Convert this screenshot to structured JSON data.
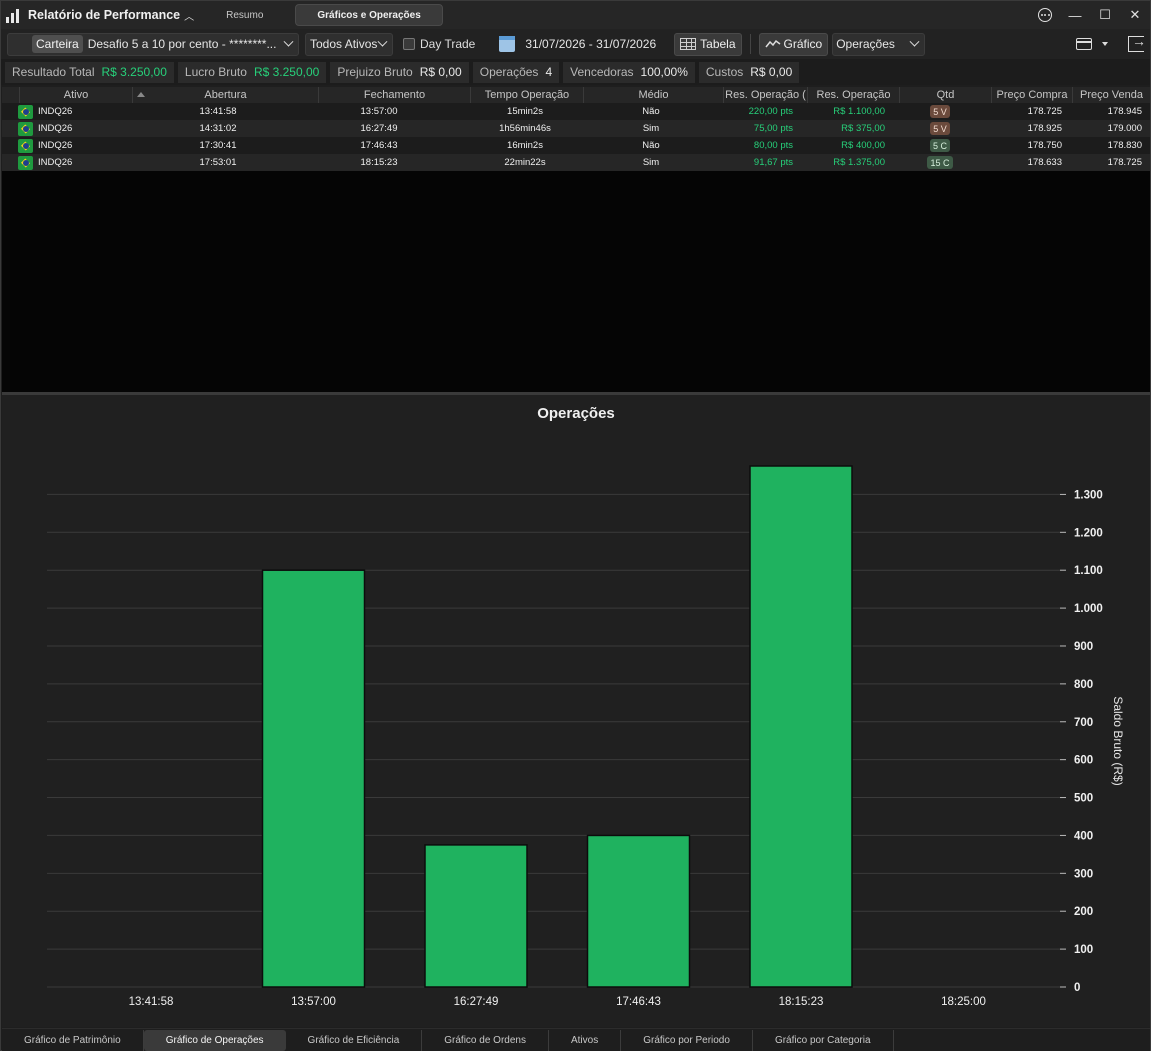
{
  "window": {
    "title": "Relatório de Performance",
    "tabs": [
      {
        "label": "Resumo",
        "active": false
      },
      {
        "label": "Gráficos e Operações",
        "active": true
      }
    ]
  },
  "toolbar": {
    "carteira_tag": "Carteira",
    "carteira_value": "Desafio 5 a 10 por cento  - ********...",
    "ativos_value": "Todos Ativos",
    "day_trade_label": "Day Trade",
    "day_trade_checked": false,
    "date_range": "31/07/2026 - 31/07/2026",
    "tabela_label": "Tabela",
    "grafico_label": "Gráfico",
    "operacoes_select": "Operações"
  },
  "summary": [
    {
      "label": "Resultado Total",
      "value": "R$ 3.250,00",
      "positive": true
    },
    {
      "label": "Lucro Bruto",
      "value": "R$ 3.250,00",
      "positive": true
    },
    {
      "label": "Prejuizo Bruto",
      "value": "R$ 0,00",
      "positive": false
    },
    {
      "label": "Operações",
      "value": "4",
      "positive": false
    },
    {
      "label": "Vencedoras",
      "value": "100,00%",
      "positive": false
    },
    {
      "label": "Custos",
      "value": "R$ 0,00",
      "positive": false
    }
  ],
  "table": {
    "columns": [
      "Ativo",
      "Abertura",
      "Fechamento",
      "Tempo Operação",
      "Médio",
      "Res. Operação (",
      "Res. Operação",
      "Qtd",
      "Preço Compra",
      "Preço Venda"
    ],
    "rows": [
      {
        "ativo": "INDQ26",
        "abertura": "13:41:58",
        "fechamento": "13:57:00",
        "tempo": "15min2s",
        "medio": "Não",
        "res_pts": "220,00 pts",
        "res_rs": "R$ 1.100,00",
        "qtd": "5 V",
        "qtd_side": "v",
        "compra": "178.725",
        "venda": "178.945"
      },
      {
        "ativo": "INDQ26",
        "abertura": "14:31:02",
        "fechamento": "16:27:49",
        "tempo": "1h56min46s",
        "medio": "Sim",
        "res_pts": "75,00 pts",
        "res_rs": "R$ 375,00",
        "qtd": "5 V",
        "qtd_side": "v",
        "compra": "178.925",
        "venda": "179.000"
      },
      {
        "ativo": "INDQ26",
        "abertura": "17:30:41",
        "fechamento": "17:46:43",
        "tempo": "16min2s",
        "medio": "Não",
        "res_pts": "80,00 pts",
        "res_rs": "R$ 400,00",
        "qtd": "5 C",
        "qtd_side": "c",
        "compra": "178.750",
        "venda": "178.830"
      },
      {
        "ativo": "INDQ26",
        "abertura": "17:53:01",
        "fechamento": "18:15:23",
        "tempo": "22min22s",
        "medio": "Sim",
        "res_pts": "91,67 pts",
        "res_rs": "R$ 1.375,00",
        "qtd": "15 C",
        "qtd_side": "c",
        "compra": "178.633",
        "venda": "178.725"
      }
    ]
  },
  "chart_data": {
    "type": "bar",
    "title": "Operações",
    "ylabel": "Saldo Bruto (R$)",
    "xlabel": "",
    "categories": [
      "13:41:58",
      "13:57:00",
      "16:27:49",
      "17:46:43",
      "18:15:23",
      "18:25:00"
    ],
    "values": [
      0,
      1100,
      375,
      400,
      1375,
      0
    ],
    "ylim": [
      0,
      1375
    ],
    "yticks": [
      0,
      100,
      200,
      300,
      400,
      500,
      600,
      700,
      800,
      900,
      1000,
      1100,
      1200,
      1300
    ],
    "ytick_labels": [
      "0",
      "100",
      "200",
      "300",
      "400",
      "500",
      "600",
      "700",
      "800",
      "900",
      "1.000",
      "1.100",
      "1.200",
      "1.300"
    ],
    "y_axis_position": "right",
    "grid": true,
    "bar_color": "#1fb25f"
  },
  "bottom_tabs": [
    {
      "label": "Gráfico de Patrimônio",
      "active": false
    },
    {
      "label": "Gráfico de Operações",
      "active": true
    },
    {
      "label": "Gráfico de Eficiência",
      "active": false
    },
    {
      "label": "Gráfico de Ordens",
      "active": false
    },
    {
      "label": "Ativos",
      "active": false
    },
    {
      "label": "Gráfico por Periodo",
      "active": false
    },
    {
      "label": "Gráfico por Categoria",
      "active": false
    }
  ]
}
